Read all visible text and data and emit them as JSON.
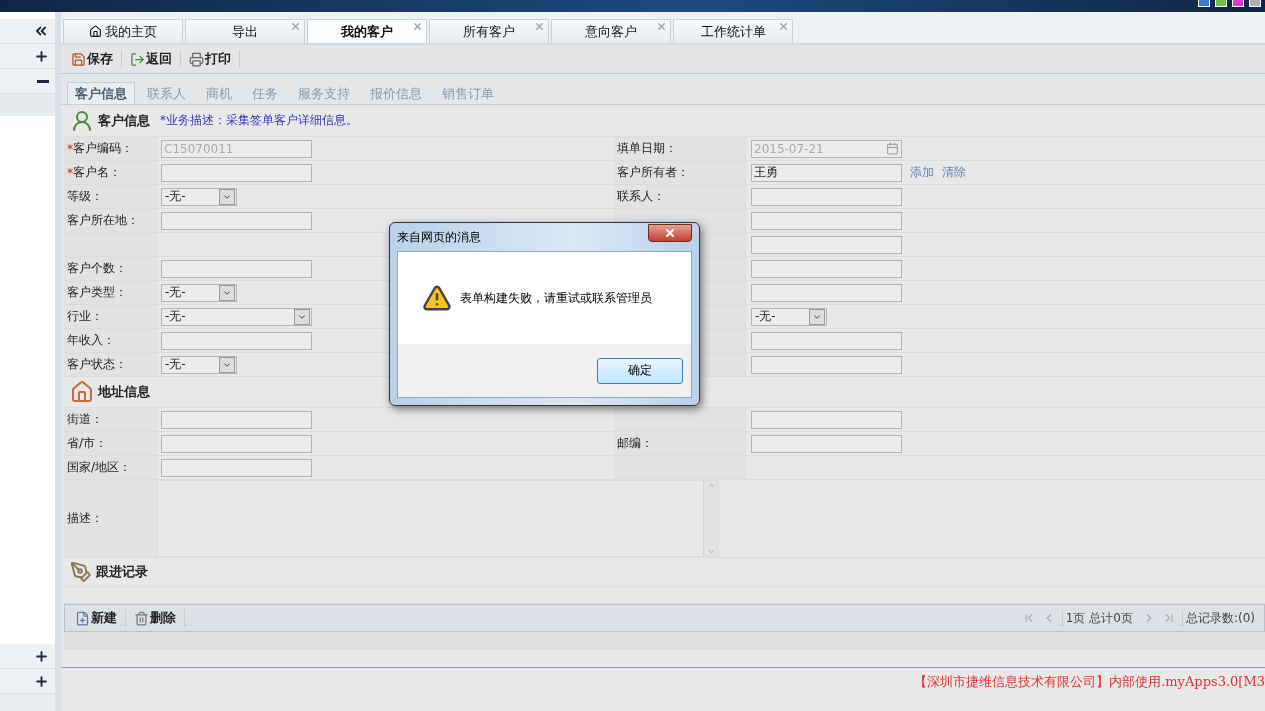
{
  "top_bar": {
    "theme_swatches": [
      {
        "color": "#3a78c8"
      },
      {
        "color": "#6cc644"
      },
      {
        "color": "#d63fcf"
      },
      {
        "color": "#b0b0b0"
      }
    ]
  },
  "sidebar": {
    "top_buttons": [
      {
        "kind": "collapse"
      },
      {
        "kind": "expand"
      },
      {
        "kind": "shrink"
      }
    ],
    "bottom_buttons": [
      {
        "kind": "expand"
      },
      {
        "kind": "expand"
      }
    ]
  },
  "tabs": [
    {
      "label": "我的主页",
      "kind": "home",
      "selected": false
    },
    {
      "label": "导出",
      "kind": "closable",
      "selected": false
    },
    {
      "label": "我的客户",
      "kind": "closable",
      "selected": true
    },
    {
      "label": "所有客户",
      "kind": "closable",
      "selected": false
    },
    {
      "label": "意向客户",
      "kind": "closable",
      "selected": false
    },
    {
      "label": "工作统计单",
      "kind": "closable",
      "selected": false
    }
  ],
  "toolbar": [
    {
      "label": "保存",
      "kind": "save"
    },
    {
      "label": "返回",
      "kind": "back"
    },
    {
      "label": "打印",
      "kind": "print"
    }
  ],
  "subtabs": [
    {
      "label": "客户信息",
      "selected": true
    },
    {
      "label": "联系人",
      "selected": false
    },
    {
      "label": "商机",
      "selected": false
    },
    {
      "label": "任务",
      "selected": false
    },
    {
      "label": "服务支持",
      "selected": false
    },
    {
      "label": "报价信息",
      "selected": false
    },
    {
      "label": "销售订单",
      "selected": false
    }
  ],
  "customer_section": {
    "title": "客户信息",
    "description": "*业务描述：采集签单客户详细信息。"
  },
  "customer_rows": [
    {
      "left": {
        "mark": "*",
        "label": "客户编码：",
        "kind": "text",
        "value": "C15070011",
        "disabled": true
      },
      "right": {
        "label": "填单日期：",
        "kind": "date",
        "value": "2015-07-21",
        "disabled": true
      }
    },
    {
      "left": {
        "mark": "*",
        "label": "客户名：",
        "kind": "text"
      },
      "right": {
        "label": "客户所有者：",
        "kind": "text",
        "value": "王勇",
        "disabled": false,
        "links": [
          "添加",
          "清除"
        ]
      }
    },
    {
      "left": {
        "label": "等级：",
        "kind": "select",
        "value": "-无-"
      },
      "right": {
        "label": "联系人：",
        "kind": "text"
      }
    },
    {
      "left": {
        "label": "客户所在地：",
        "kind": "text"
      },
      "right": {
        "kind": "text"
      }
    },
    {
      "left": {
        "kind": "blank"
      },
      "right": {
        "kind": "text"
      }
    },
    {
      "left": {
        "label": "客户个数：",
        "kind": "text"
      },
      "right": {
        "kind": "text"
      }
    },
    {
      "left": {
        "label": "客户类型：",
        "kind": "select",
        "value": "-无-"
      },
      "right": {
        "kind": "text"
      }
    },
    {
      "left": {
        "label": "行业：",
        "kind": "wide-select",
        "value": "-无-"
      },
      "right": {
        "kind": "select",
        "value": "-无-"
      }
    },
    {
      "left": {
        "label": "年收入：",
        "kind": "text"
      },
      "right": {
        "kind": "text"
      }
    },
    {
      "left": {
        "label": "客户状态：",
        "kind": "select",
        "value": "-无-"
      },
      "right": {
        "kind": "text"
      }
    }
  ],
  "address_section": {
    "title": "地址信息"
  },
  "address_rows": [
    {
      "left": {
        "label": "街道：",
        "kind": "text"
      },
      "right": {
        "kind": "text"
      }
    },
    {
      "left": {
        "label": "省/市：",
        "kind": "text"
      },
      "right": {
        "label": "邮编：",
        "kind": "text"
      }
    },
    {
      "left": {
        "label": "国家/地区：",
        "kind": "text"
      },
      "right": {
        "kind": "blank"
      }
    }
  ],
  "description": {
    "label": "描述："
  },
  "followup_section": {
    "title": "跟进记录",
    "toolbar": [
      {
        "label": "新建",
        "kind": "new"
      },
      {
        "label": "删除",
        "kind": "delete"
      }
    ],
    "pager": {
      "page": "1页 总计0页",
      "total": "总记录数:(0)"
    }
  },
  "footer": {
    "notice": "【深圳市捷维信息技术有限公司】内部使用.myApps3.0[M3"
  },
  "dialog": {
    "title": "来自网页的消息",
    "message": "表单构建失败，请重试或联系管理员",
    "ok": "确定"
  }
}
